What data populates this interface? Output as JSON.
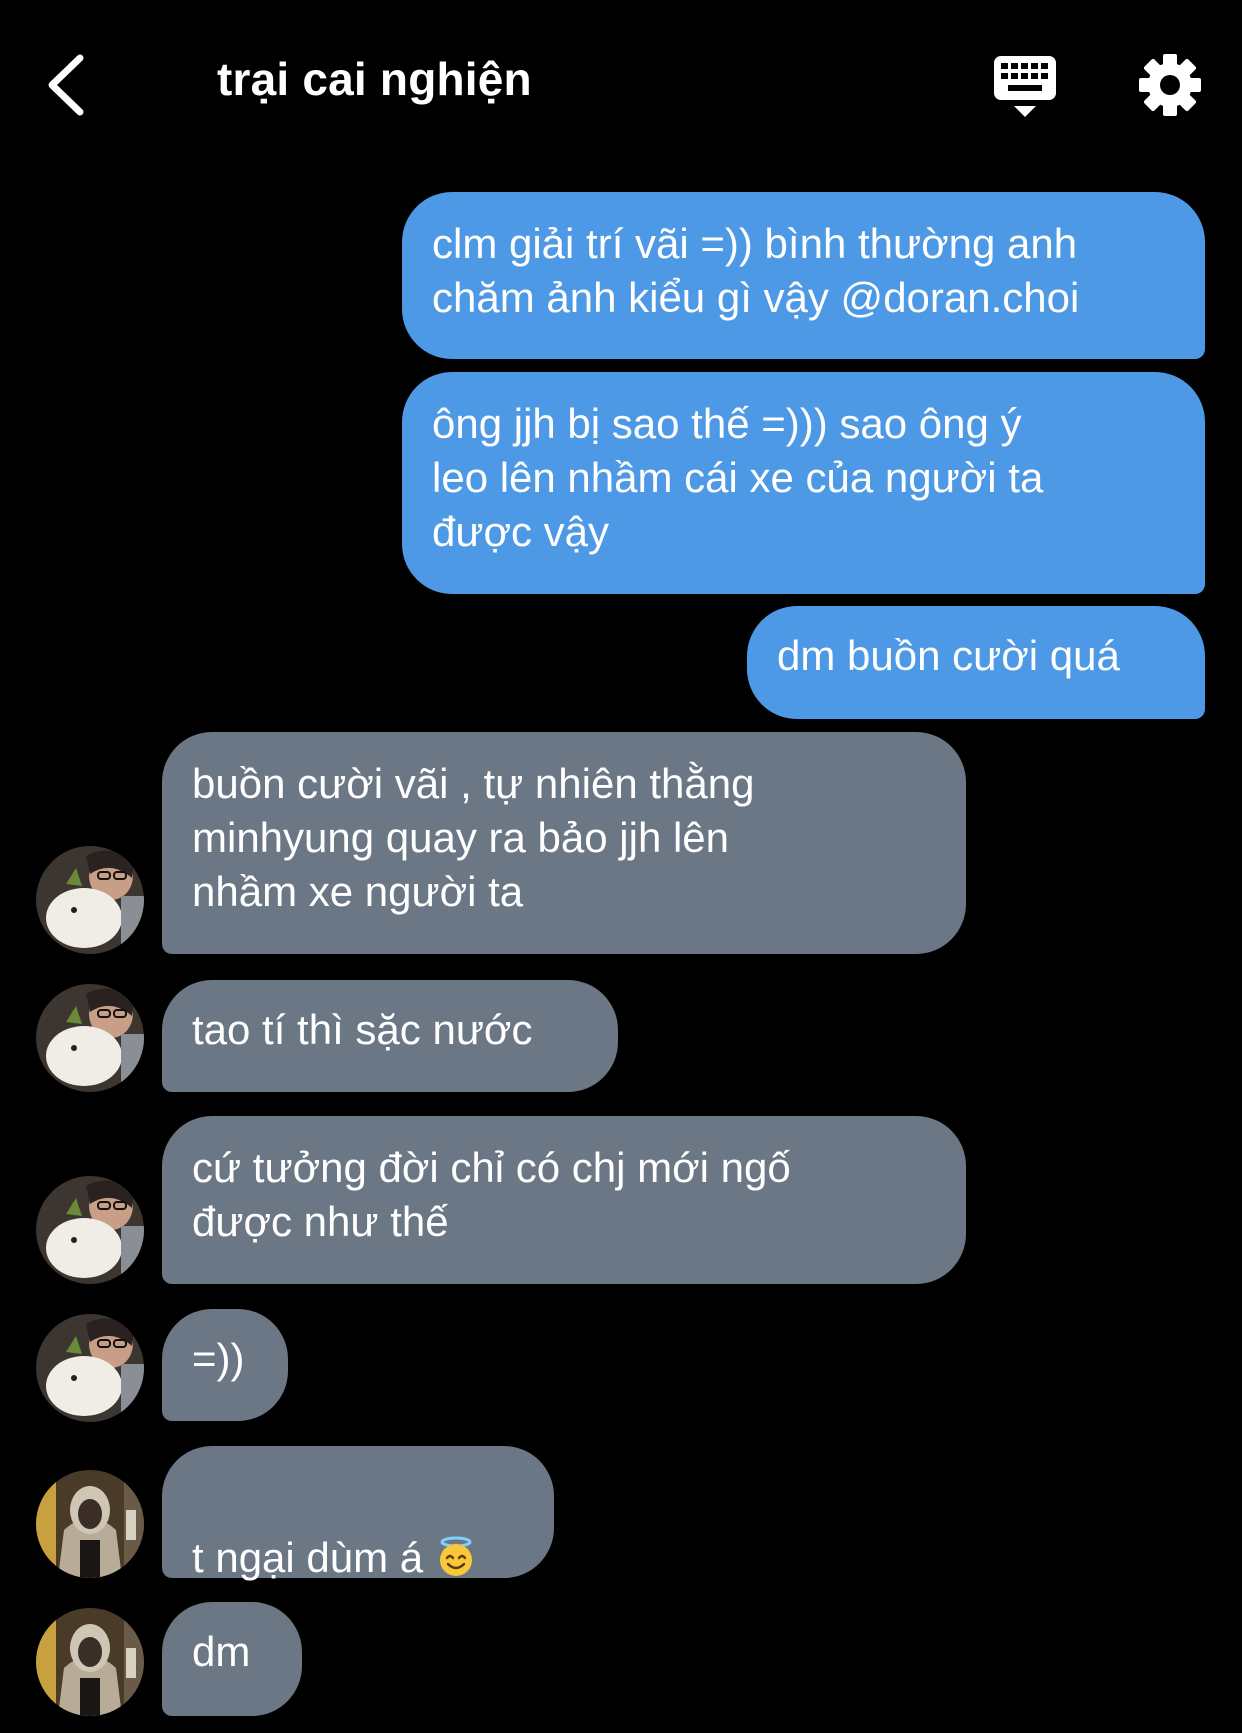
{
  "header": {
    "title": "trại cai nghiện",
    "back_icon": "chevron-left-icon",
    "keyboard_icon": "keyboard-icon",
    "settings_icon": "gear-icon"
  },
  "colors": {
    "background": "#000000",
    "outgoing_bubble": "#4d99e6",
    "incoming_bubble": "#6b7785"
  },
  "messages": [
    {
      "direction": "outgoing",
      "text": "clm giải trí vãi =)) bình thường anh\nchăm ảnh kiểu gì vậy @doran.choi"
    },
    {
      "direction": "outgoing",
      "text": "ông jjh bị sao thế =))) sao ông ý\nleo lên nhầm cái xe của người ta\nđược vậy"
    },
    {
      "direction": "outgoing",
      "text": "dm buồn cười quá"
    },
    {
      "direction": "incoming",
      "text": "buồn cười vãi , tự nhiên thằng\nminhyung quay ra bảo jjh lên\nnhầm xe người ta"
    },
    {
      "direction": "incoming",
      "text": "tao tí thì sặc nước"
    },
    {
      "direction": "incoming",
      "text": "cứ tưởng đời chỉ có chj mới ngố\nđược như thế"
    },
    {
      "direction": "incoming",
      "text": "=))"
    },
    {
      "direction": "incoming",
      "text": "t ngại dùm á",
      "emoji": "smiling-face-with-halo"
    },
    {
      "direction": "incoming",
      "text": "dm"
    }
  ]
}
